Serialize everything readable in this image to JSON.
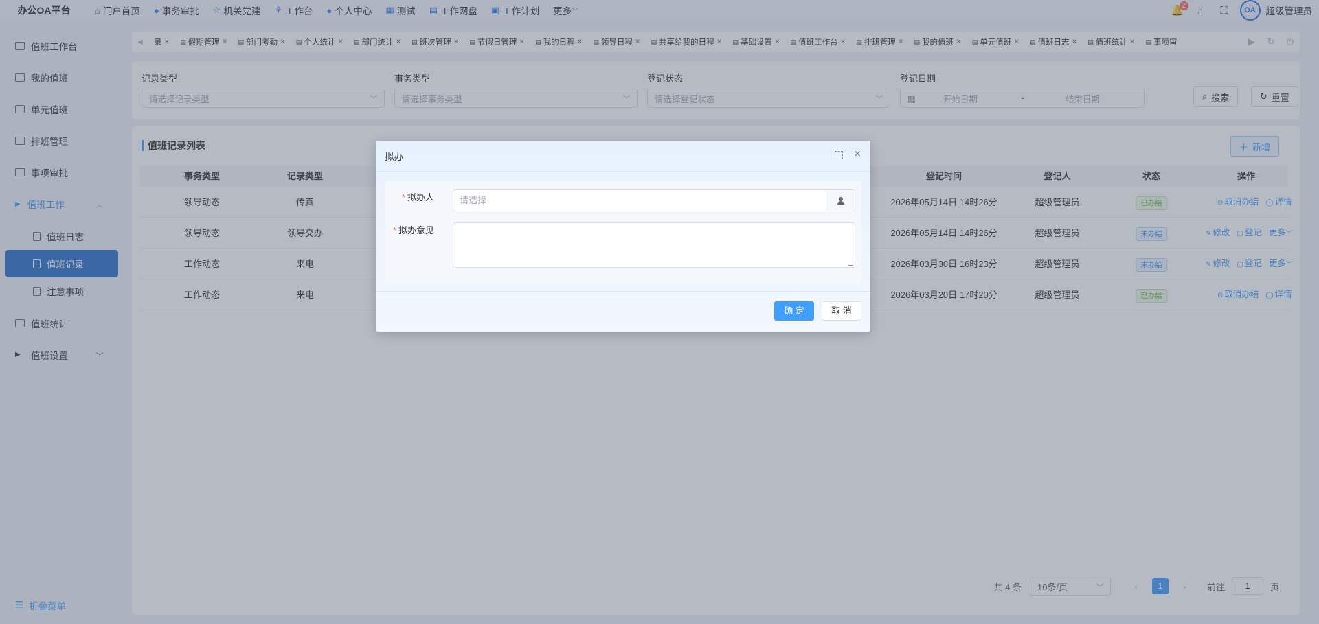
{
  "app": {
    "brand": "办公OA平台",
    "username": "超级管理员",
    "notif_count": "2",
    "avatar_text": "OA"
  },
  "topnav": [
    {
      "label": "门户首页",
      "icon": "⌂"
    },
    {
      "label": "事务审批",
      "icon": "●"
    },
    {
      "label": "机关党建",
      "icon": "☆"
    },
    {
      "label": "工作台",
      "icon": "⚘"
    },
    {
      "label": "个人中心",
      "icon": "●"
    },
    {
      "label": "测试",
      "icon": "▦"
    },
    {
      "label": "工作网盘",
      "icon": "▤"
    },
    {
      "label": "工作计划",
      "icon": "▣"
    },
    {
      "label": "更多",
      "icon": ""
    }
  ],
  "sidebar": {
    "items": [
      {
        "label": "值班工作台"
      },
      {
        "label": "我的值班"
      },
      {
        "label": "单元值班"
      },
      {
        "label": "排班管理"
      },
      {
        "label": "事项审批"
      }
    ],
    "group": {
      "label": "值班工作"
    },
    "subitems": [
      {
        "label": "值班日志"
      },
      {
        "label": "值班记录"
      },
      {
        "label": "注意事项"
      }
    ],
    "after": [
      {
        "label": "值班统计"
      },
      {
        "label": "值班设置"
      }
    ],
    "collapse": "折叠菜单"
  },
  "tabs": [
    {
      "label": "录"
    },
    {
      "label": "假期管理"
    },
    {
      "label": "部门考勤"
    },
    {
      "label": "个人统计"
    },
    {
      "label": "部门统计"
    },
    {
      "label": "班次管理"
    },
    {
      "label": "节假日管理"
    },
    {
      "label": "我的日程"
    },
    {
      "label": "领导日程"
    },
    {
      "label": "共享给我的日程"
    },
    {
      "label": "基础设置"
    },
    {
      "label": "值班工作台"
    },
    {
      "label": "排班管理"
    },
    {
      "label": "我的值班"
    },
    {
      "label": "单元值班"
    },
    {
      "label": "值班日志"
    },
    {
      "label": "值班统计"
    },
    {
      "label": "事项审"
    }
  ],
  "filters": {
    "record_type": {
      "label": "记录类型",
      "placeholder": "请选择记录类型"
    },
    "affair_type": {
      "label": "事务类型",
      "placeholder": "请选择事务类型"
    },
    "reg_status": {
      "label": "登记状态",
      "placeholder": "请选择登记状态"
    },
    "reg_date": {
      "label": "登记日期",
      "start": "开始日期",
      "sep": "-",
      "end": "结束日期"
    },
    "search": "搜索",
    "reset": "重置"
  },
  "list": {
    "title": "值班记录列表",
    "add": "新增",
    "columns": [
      "事务类型",
      "记录类型",
      "登记时间",
      "登记人",
      "状态",
      "操作"
    ],
    "rows": [
      {
        "affair": "领导动态",
        "record": "传真",
        "time": "2026年05月14日 14时26分",
        "user": "超级管理员",
        "status": "已办结",
        "status_kind": "done",
        "ops": [
          "取消办结",
          "详情"
        ]
      },
      {
        "affair": "领导动态",
        "record": "领导交办",
        "time": "2026年05月14日 14时26分",
        "user": "超级管理员",
        "status": "未办结",
        "status_kind": "todo",
        "ops": [
          "修改",
          "登记",
          "更多"
        ]
      },
      {
        "affair": "工作动态",
        "record": "来电",
        "time": "2026年03月30日 16时23分",
        "user": "超级管理员",
        "status": "未办结",
        "status_kind": "todo",
        "ops": [
          "修改",
          "登记",
          "更多"
        ]
      },
      {
        "affair": "工作动态",
        "record": "来电",
        "time": "2026年03月20日 17时20分",
        "user": "超级管理员",
        "status": "已办结",
        "status_kind": "done",
        "ops": [
          "取消办结",
          "详情"
        ]
      }
    ]
  },
  "pager": {
    "total": "共 4 条",
    "page_size": "10条/页",
    "current": "1",
    "goto": "前往",
    "goto_value": "1",
    "page_unit": "页"
  },
  "dialog": {
    "title": "拟办",
    "assignee_label": "拟办人",
    "assignee_placeholder": "请选择",
    "opinion_label": "拟办意见",
    "ok": "确 定",
    "cancel": "取 消"
  },
  "colors": {
    "primary": "#409eff",
    "active_menu": "#2b73ce",
    "success": "#67c23a"
  }
}
